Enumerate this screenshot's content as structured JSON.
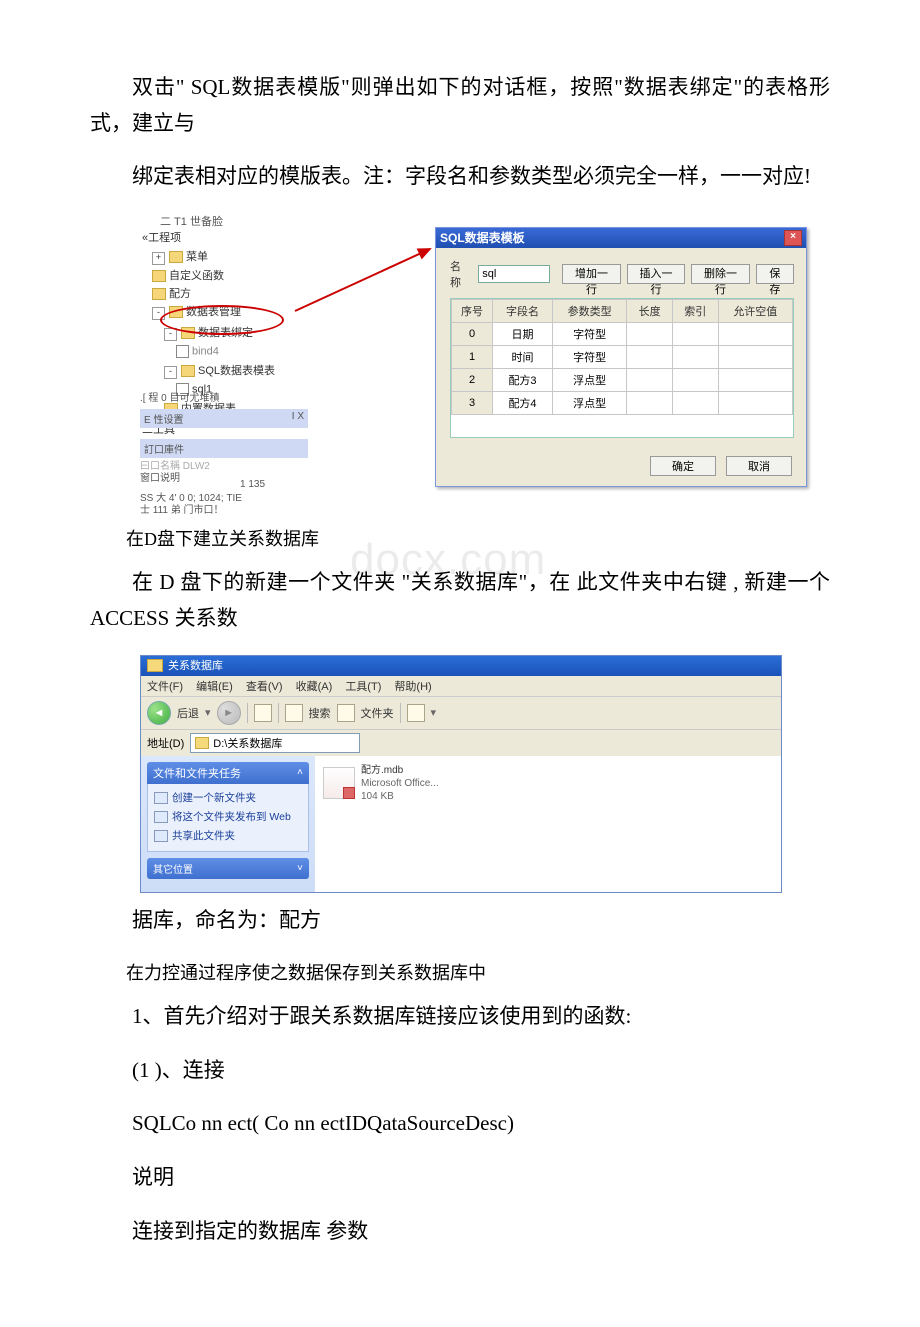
{
  "paragraphs": {
    "p1": "双击\" SQL数据表模版\"则弹出如下的对话框，按照\"数据表绑定\"的表格形式，建立与",
    "p2": "绑定表相对应的模版表。注：字段名和参数类型必须完全一样，一一对应!",
    "p3": "在D盘下建立关系数据库",
    "p4": "在 D 盘下的新建一个文件夹 \"关系数据库\"，在 此文件夹中右键 ,   新建一个 ACCESS 关系数",
    "p5": "据库，命名为：配方",
    "p6": "在力控通过程序使之数据保存到关系数据库中",
    "p7": "1、首先介绍对于跟关系数据库链接应该使用到的函数:",
    "p8": "(1 )、连接",
    "p9": "SQLCo nn ect( Co nn ectIDQataSourceDesc)",
    "p10": "说明",
    "p11": "连接到指定的数据库 参数",
    "watermark": "docx.com"
  },
  "shot1": {
    "tree": {
      "root": "二 T1 世备脸",
      "sub0": "«工程项",
      "items": [
        "菜单",
        "自定义函数",
        "配方",
        "数据表管理",
        "数据表绑定",
        "bind4",
        "SQL数据表模表",
        "sql1",
        "内置数据表"
      ],
      "util": "二工具"
    },
    "misc": {
      "m1": ".[ 程 0 目可尤堆積",
      "m2": "E 性设置",
      "m3": "訂口庫件",
      "m4": "曰口名稱           DLW2",
      "m5": "窗口说明",
      "m6": "1 135",
      "m7": "SS 大 4'        0 0; 1024; TIE",
      "m8": "士 111 弟 门市口！",
      "ix": "I  X"
    },
    "dialog": {
      "title": "SQL数据表模板",
      "name_label": "名称",
      "name_value": "sql",
      "btn_add_row": "增加一行",
      "btn_insert_row": "插入一行",
      "btn_delete_row": "删除一行",
      "btn_save": "保存",
      "btn_ok": "确定",
      "btn_cancel": "取消",
      "columns": [
        "序号",
        "字段名",
        "参数类型",
        "长度",
        "索引",
        "允许空值"
      ],
      "rows": [
        {
          "idx": "0",
          "field": "日期",
          "type": "字符型",
          "len": "",
          "index": "",
          "nullable": ""
        },
        {
          "idx": "1",
          "field": "时间",
          "type": "字符型",
          "len": "",
          "index": "",
          "nullable": ""
        },
        {
          "idx": "2",
          "field": "配方3",
          "type": "浮点型",
          "len": "",
          "index": "",
          "nullable": ""
        },
        {
          "idx": "3",
          "field": "配方4",
          "type": "浮点型",
          "len": "",
          "index": "",
          "nullable": ""
        }
      ]
    }
  },
  "shot2": {
    "title": "关系数据库",
    "menu": [
      "文件(F)",
      "编辑(E)",
      "查看(V)",
      "收藏(A)",
      "工具(T)",
      "帮助(H)"
    ],
    "toolbar": {
      "back": "后退",
      "search": "搜索",
      "folders": "文件夹"
    },
    "address_label": "地址(D)",
    "address_value": "D:\\关系数据库",
    "panel1_title": "文件和文件夹任务",
    "panel1_items": [
      "创建一个新文件夹",
      "将这个文件夹发布到 Web",
      "共享此文件夹"
    ],
    "panel2_title": "其它位置",
    "file": {
      "name": "配方.mdb",
      "line2": "Microsoft Office...",
      "line3": "104 KB"
    }
  }
}
